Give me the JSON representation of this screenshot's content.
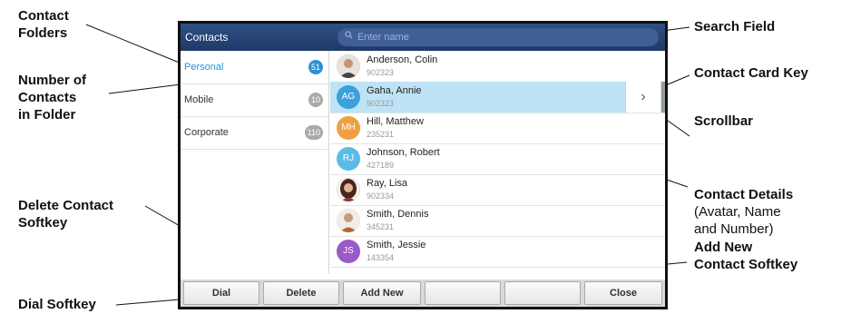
{
  "callouts": {
    "contact_folders": [
      "Contact",
      "Folders"
    ],
    "number_of_contacts": [
      "Number of",
      "Contacts",
      "in Folder"
    ],
    "delete_softkey": [
      "Delete Contact",
      "Softkey"
    ],
    "dial_softkey": "Dial Softkey",
    "search_field": "Search Field",
    "contact_card_key": "Contact Card Key",
    "scrollbar": "Scrollbar",
    "contact_details": "Contact Details",
    "contact_details_sub": [
      "(Avatar, Name",
      "and Number)"
    ],
    "add_new_softkey": [
      "Add New",
      "Contact Softkey"
    ]
  },
  "screen": {
    "title": "Contacts",
    "search_placeholder": "Enter name",
    "folders": [
      {
        "name": "Personal",
        "count": "51",
        "active": true
      },
      {
        "name": "Mobile",
        "count": "10",
        "active": false
      },
      {
        "name": "Corporate",
        "count": "110",
        "active": false
      }
    ],
    "contacts": [
      {
        "name": "Anderson, Colin",
        "number": "902323",
        "initials": "",
        "avatar_color": "#b88a6a",
        "photo": true
      },
      {
        "name": "Gaha, Annie",
        "number": "902323",
        "initials": "AG",
        "avatar_color": "#3aa0e0",
        "photo": false,
        "selected": true
      },
      {
        "name": "Hill, Matthew",
        "number": "235231",
        "initials": "MH",
        "avatar_color": "#f0a040",
        "photo": false
      },
      {
        "name": "Johnson, Robert",
        "number": "427189",
        "initials": "RJ",
        "avatar_color": "#5bbbe8",
        "photo": false
      },
      {
        "name": "Ray, Lisa",
        "number": "902334",
        "initials": "",
        "avatar_color": "#6a3a2a",
        "photo": true
      },
      {
        "name": "Smith, Dennis",
        "number": "345231",
        "initials": "",
        "avatar_color": "#c89a7a",
        "photo": true
      },
      {
        "name": "Smith, Jessie",
        "number": "143354",
        "initials": "JS",
        "avatar_color": "#9a5ac8",
        "photo": false
      }
    ],
    "cardkey_glyph": "›",
    "softkeys": [
      "Dial",
      "Delete",
      "Add New",
      "",
      "",
      "Close"
    ]
  },
  "colors": {
    "titlebar": "#1e3a68",
    "accent": "#2a90d8",
    "selected_row": "#bfe3f6"
  }
}
